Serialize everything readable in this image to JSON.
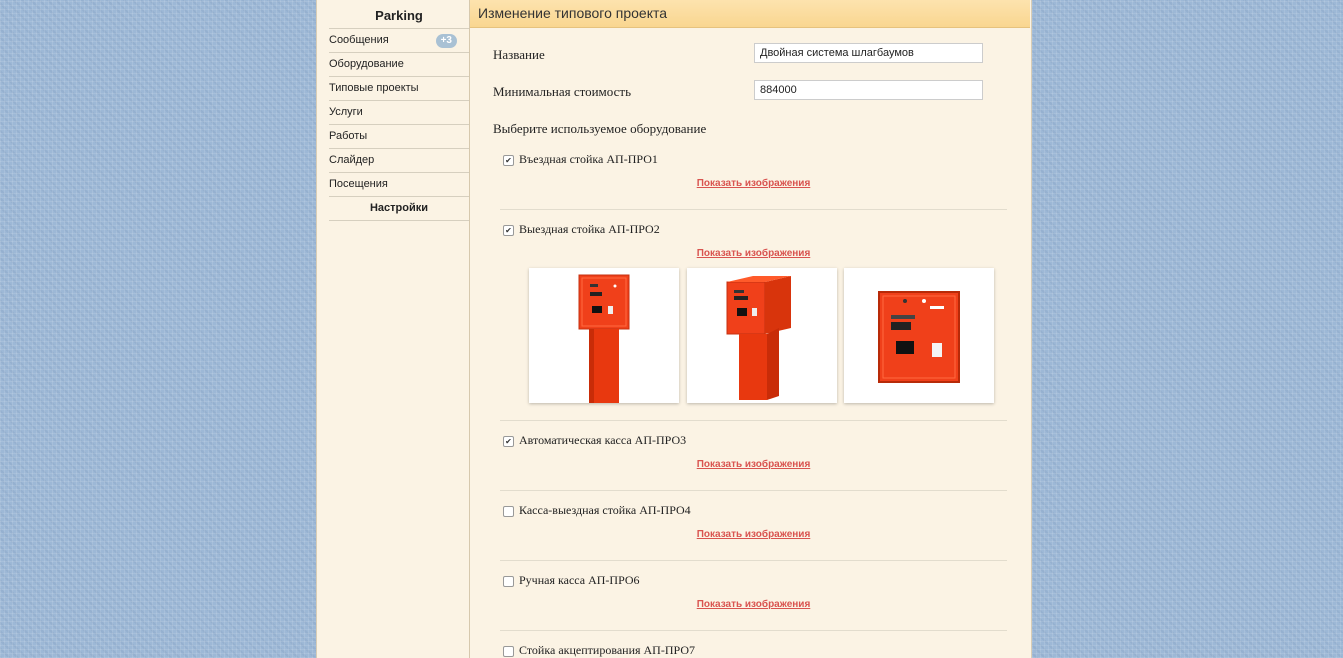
{
  "sidebar": {
    "brand": "Parking",
    "items": [
      {
        "label": "Сообщения",
        "badge": "+3"
      },
      {
        "label": "Оборудование"
      },
      {
        "label": "Типовые проекты"
      },
      {
        "label": "Услуги"
      },
      {
        "label": "Работы"
      },
      {
        "label": "Слайдер"
      },
      {
        "label": "Посещения"
      },
      {
        "label": "Настройки"
      }
    ]
  },
  "header": {
    "title": "Изменение типового проекта"
  },
  "form": {
    "name_label": "Название",
    "name_value": "Двойная система шлагбаумов",
    "cost_label": "Минимальная стоимость",
    "cost_value": "884000",
    "equipment_title": "Выберите используемое оборудование"
  },
  "show_images_label": "Показать изображения",
  "equipment": [
    {
      "label": "Въездная стойка АП-ПРО1",
      "checked": true
    },
    {
      "label": "Выездная стойка АП-ПРО2",
      "checked": true
    },
    {
      "label": "Автоматическая касса АП-ПРО3",
      "checked": true
    },
    {
      "label": "Касса-выездная стойка АП-ПРО4",
      "checked": false
    },
    {
      "label": "Ручная касса АП-ПРО6",
      "checked": false
    },
    {
      "label": "Стойка акцептирования АП-ПРО7",
      "checked": false
    }
  ],
  "colors": {
    "accent": "#d9534f",
    "device": "#f0401a",
    "header": "#fcdca0"
  }
}
